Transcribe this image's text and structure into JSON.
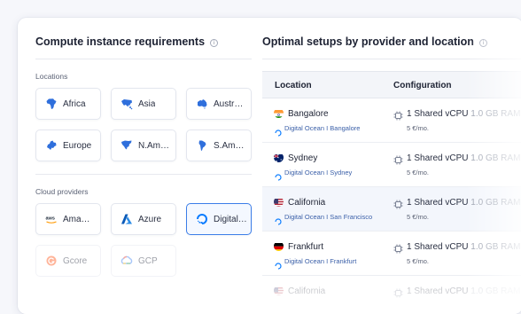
{
  "left_panel": {
    "title": "Compute instance requirements",
    "locations_label": "Locations",
    "locations": [
      {
        "label": "Africa",
        "icon": "africa-map-icon"
      },
      {
        "label": "Asia",
        "icon": "asia-map-icon"
      },
      {
        "label": "Austr…",
        "icon": "australia-map-icon"
      },
      {
        "label": "Europe",
        "icon": "europe-map-icon"
      },
      {
        "label": "N.Am…",
        "icon": "north-america-map-icon"
      },
      {
        "label": "S.Am…",
        "icon": "south-america-map-icon"
      }
    ],
    "providers_label": "Cloud providers",
    "providers": [
      {
        "label": "Ama…",
        "icon": "aws-logo-icon",
        "state": "normal"
      },
      {
        "label": "Azure",
        "icon": "azure-logo-icon",
        "state": "normal"
      },
      {
        "label": "Digital…",
        "icon": "digitalocean-logo-icon",
        "state": "selected"
      },
      {
        "label": "Gcore",
        "icon": "gcore-logo-icon",
        "state": "disabled"
      },
      {
        "label": "GCP",
        "icon": "gcp-logo-icon",
        "state": "disabled"
      }
    ]
  },
  "right_panel": {
    "title": "Optimal setups by provider and location",
    "columns": [
      "Location",
      "Configuration"
    ],
    "rows": [
      {
        "city": "Bangalore",
        "flag": "india-flag-icon",
        "provider": "Digital Ocean I Bangalore",
        "config": "1 Shared vCPU",
        "memory": "1.0 GB RAM",
        "price": "5 €/mo.",
        "highlighted": false
      },
      {
        "city": "Sydney",
        "flag": "australia-flag-icon",
        "provider": "Digital Ocean I Sydney",
        "config": "1 Shared vCPU",
        "memory": "1.0 GB RAM",
        "price": "5 €/mo.",
        "highlighted": false
      },
      {
        "city": "California",
        "flag": "usa-flag-icon",
        "provider": "Digital Ocean I San Francisco",
        "config": "1 Shared vCPU",
        "memory": "1.0 GB RAM",
        "price": "5 €/mo.",
        "highlighted": true
      },
      {
        "city": "Frankfurt",
        "flag": "germany-flag-icon",
        "provider": "Digital Ocean I Frankfurt",
        "config": "1 Shared vCPU",
        "memory": "1.0 GB RAM",
        "price": "5 €/mo.",
        "highlighted": false
      },
      {
        "city": "California",
        "flag": "usa-flag-icon",
        "provider": "",
        "config": "1 Shared vCPU",
        "memory": "1.0 GB RAM",
        "price": "",
        "highlighted": false
      }
    ]
  },
  "colors": {
    "accent": "#3b7de8",
    "map_icon": "#2f6fdc",
    "provider_text": "#3a5fa8"
  }
}
